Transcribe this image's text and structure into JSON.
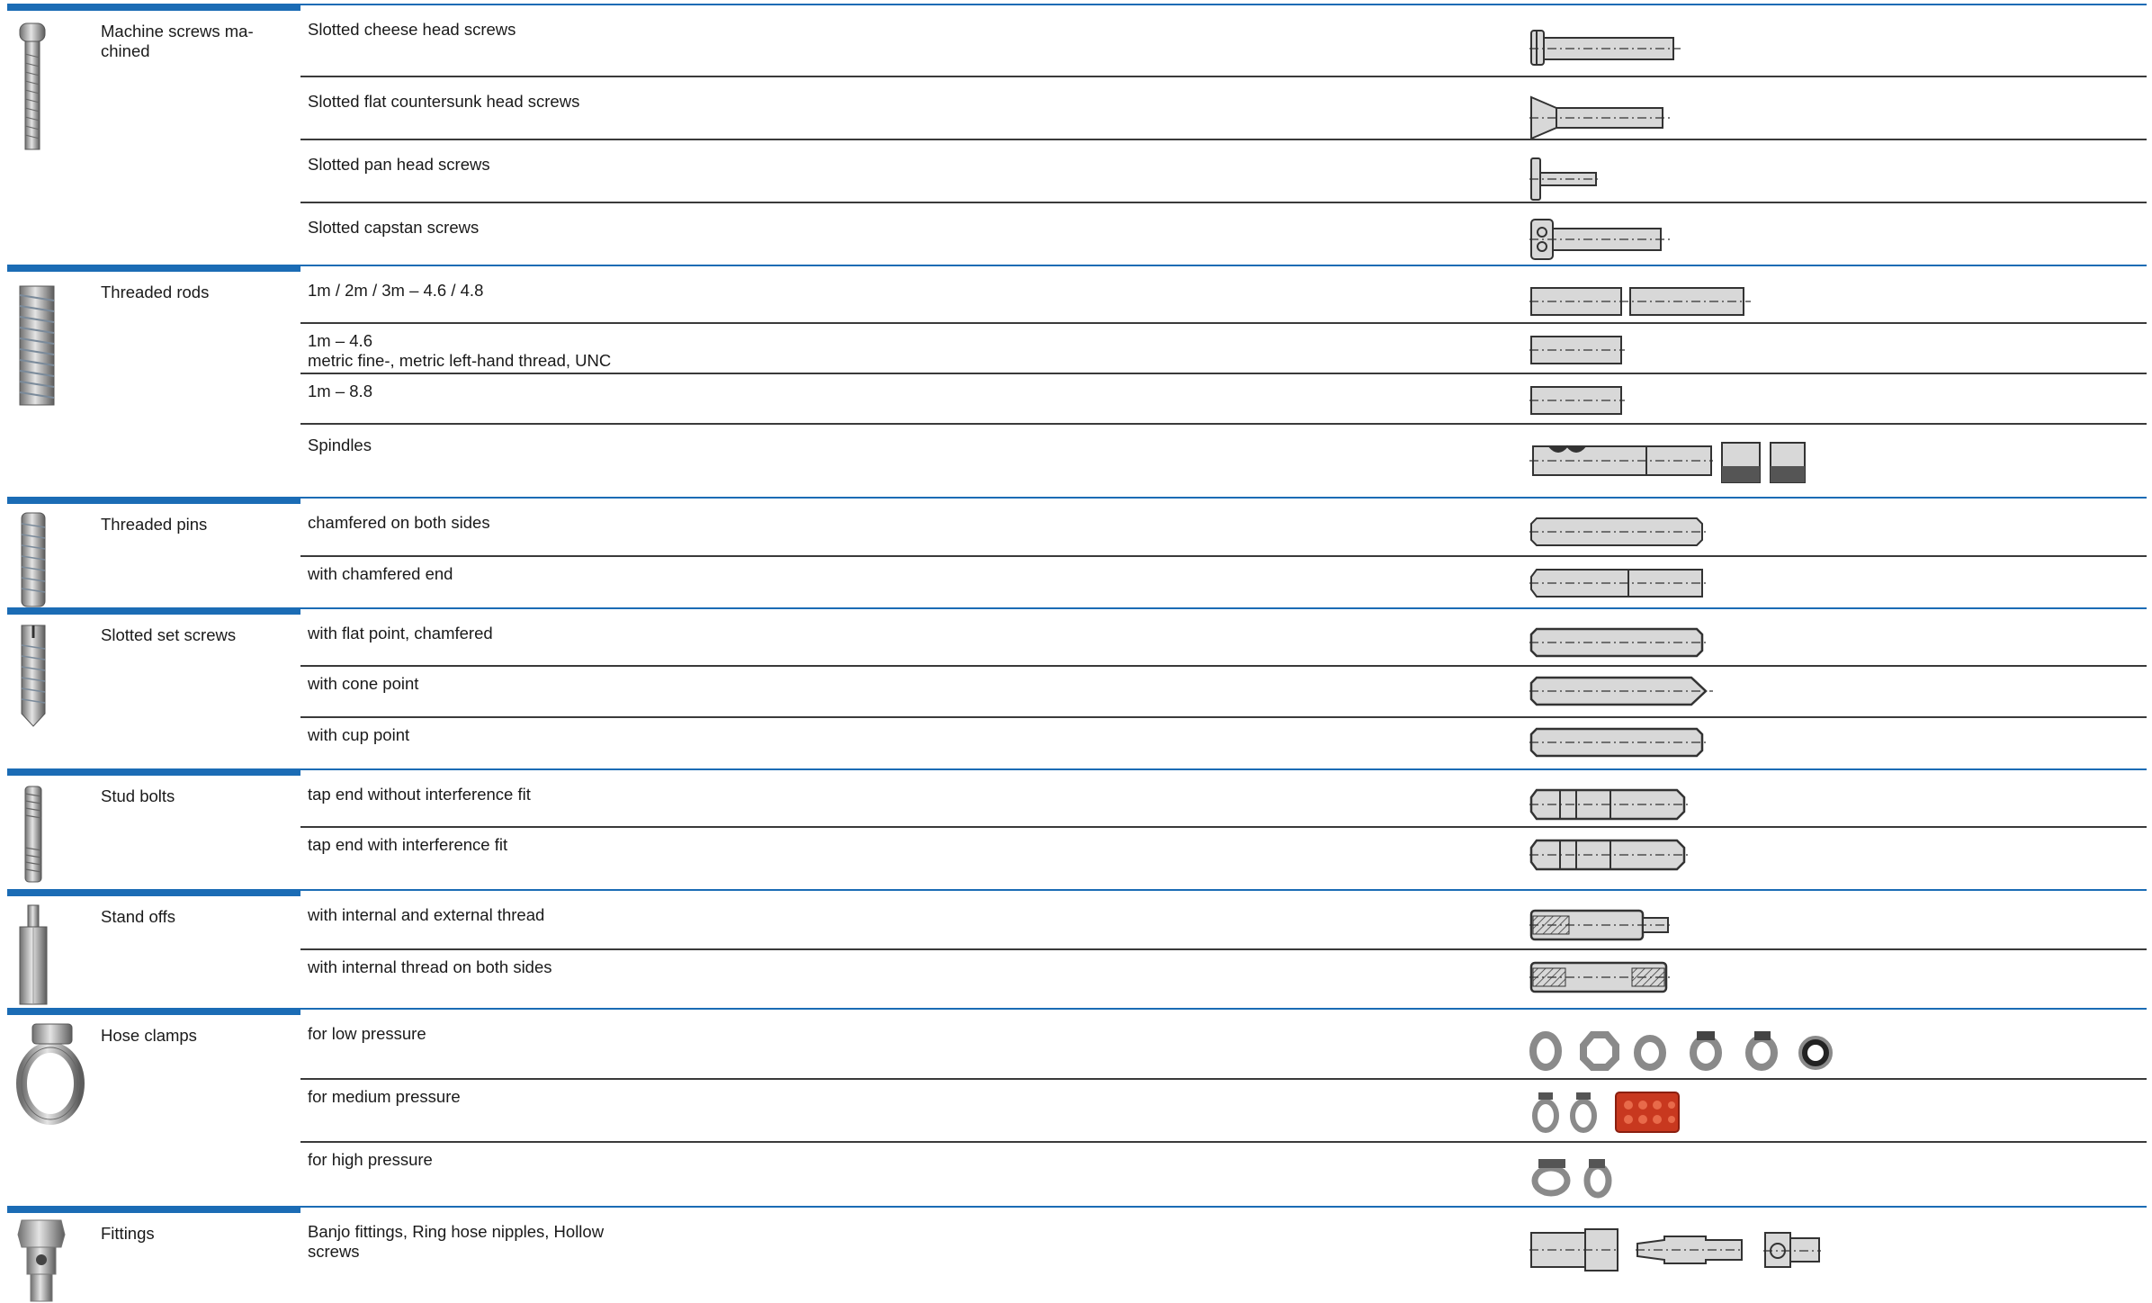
{
  "categories": [
    {
      "name": "Machine screws ma-\nchined",
      "rows": [
        "Slotted cheese head screws",
        "Slotted flat countersunk head screws",
        "Slotted pan head screws",
        "Slotted capstan screws"
      ]
    },
    {
      "name": "Threaded rods",
      "rows": [
        "1m / 2m / 3m – 4.6 / 4.8",
        "1m – 4.6\nmetric fine-, metric left-hand thread, UNC",
        "1m – 8.8",
        "Spindles"
      ]
    },
    {
      "name": "Threaded pins",
      "rows": [
        "chamfered on both sides",
        "with chamfered end"
      ]
    },
    {
      "name": "Slotted set screws",
      "rows": [
        "with flat point, chamfered",
        "with cone point",
        "with cup point"
      ]
    },
    {
      "name": "Stud bolts",
      "rows": [
        "tap end without interference fit",
        "tap end with interference fit"
      ]
    },
    {
      "name": "Stand offs",
      "rows": [
        "with internal and external thread",
        "with internal thread on both sides"
      ]
    },
    {
      "name": "Hose clamps",
      "rows": [
        "for low pressure",
        "for medium pressure",
        "for high pressure"
      ]
    },
    {
      "name": "Fittings",
      "rows": [
        "Banjo fittings, Ring hose nipples, Hollow\nscrews"
      ]
    }
  ],
  "colors": {
    "accent": "#1b6cb5",
    "part_fill": "#d8d8d8",
    "outline": "#333333"
  }
}
